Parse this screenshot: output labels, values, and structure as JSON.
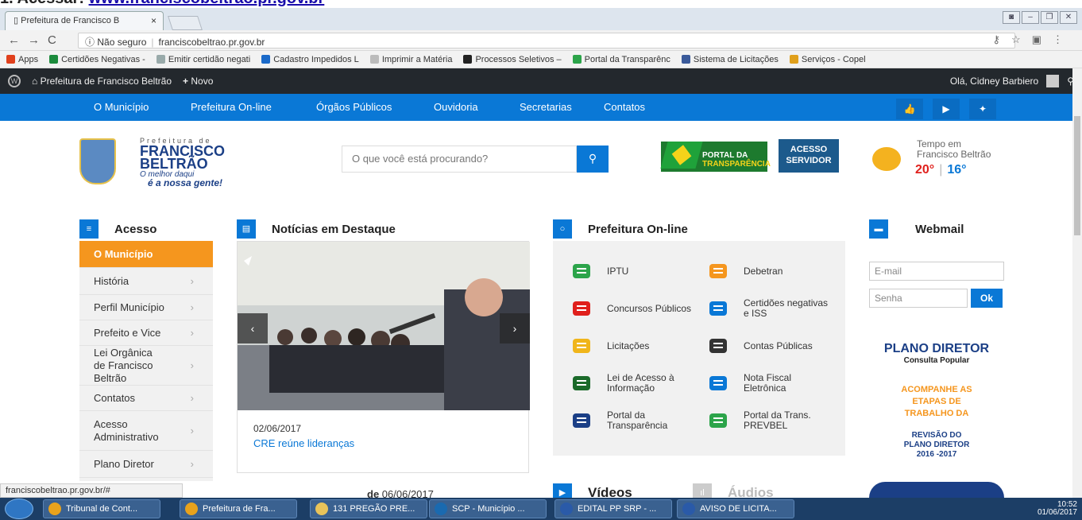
{
  "doc_header": {
    "prefix": "1. Acessar: ",
    "link": "www.franciscobeltrao.pr.gov.br"
  },
  "browser": {
    "tab_title": "Prefeitura de Francisco B",
    "security": "Não seguro",
    "url": "franciscobeltrao.pr.gov.br",
    "bookmarks": [
      {
        "label": "Apps",
        "color": "#e0401c"
      },
      {
        "label": "Certidões Negativas -",
        "color": "#1b8a3c"
      },
      {
        "label": "Emitir certidão negati",
        "color": "#9aa"
      },
      {
        "label": "Cadastro Impedidos L",
        "color": "#1b6ac9"
      },
      {
        "label": "Imprimir a Matéria",
        "color": "#bbb"
      },
      {
        "label": "Processos Seletivos –",
        "color": "#222"
      },
      {
        "label": "Portal da Transparênc",
        "color": "#2ca44a"
      },
      {
        "label": "Sistema de Licitações",
        "color": "#3a5a9a"
      },
      {
        "label": "Serviços - Copel",
        "color": "#e0a01c"
      }
    ]
  },
  "wp_bar": {
    "site": "Prefeitura de Francisco Beltrão",
    "new": "Novo",
    "greeting": "Olá, Cidney Barbiero"
  },
  "nav": [
    "O Município",
    "Prefeitura On-line",
    "Órgãos Públicos",
    "Ouvidoria",
    "Secretarias",
    "Contatos"
  ],
  "logo": {
    "line1": "Prefeitura de",
    "line2": "FRANCISCO",
    "line3": "BELTRÃO",
    "tag1": "O melhor daqui",
    "tag2": "é a nossa gente!"
  },
  "search": {
    "placeholder": "O que você está procurando?"
  },
  "portal": {
    "line1": "PORTAL DA",
    "line2": "TRANSPARÊNCIA"
  },
  "acesso_servidor": {
    "line1": "ACESSO",
    "line2": "SERVIDOR"
  },
  "weather": {
    "line1": "Tempo em",
    "line2": "Francisco Beltrão",
    "max": "20°",
    "min": "16°"
  },
  "sections": {
    "acesso": "Acesso",
    "noticias": "Notícias em Destaque",
    "online": "Prefeitura On-line",
    "webmail": "Webmail",
    "videos": "Vídeos",
    "audios": "Áudios"
  },
  "menu": [
    "O Município",
    "História",
    "Perfil Município",
    "Prefeito e Vice",
    "Lei Orgânica de Francisco Beltrão",
    "Contatos",
    "Acesso Administrativo",
    "Plano Diretor"
  ],
  "news": {
    "date": "02/06/2017",
    "caption": "CRE reúne lideranças",
    "next_date": "06/06/2017"
  },
  "online_services": [
    {
      "label": "IPTU",
      "icon": "house-icon",
      "color": "#2ca44a"
    },
    {
      "label": "Debetran",
      "icon": "car-icon",
      "color": "#f5961e"
    },
    {
      "label": "Concursos Públicos",
      "icon": "person-icon",
      "color": "#e0201c"
    },
    {
      "label": "Certidões negativas e ISS",
      "icon": "document-icon",
      "color": "#0a78d6"
    },
    {
      "label": "Licitações",
      "icon": "list-icon",
      "color": "#f0b51a"
    },
    {
      "label": "Contas Públicas",
      "icon": "calculator-icon",
      "color": "#333333"
    },
    {
      "label": "Lei de Acesso à Informação",
      "icon": "info-icon",
      "color": "#1b6a2a"
    },
    {
      "label": "Nota Fiscal Eletrônica",
      "icon": "invoice-icon",
      "color": "#0a78d6"
    },
    {
      "label": "Portal da Transparência",
      "icon": "magnifier-icon",
      "color": "#1b3f86"
    },
    {
      "label": "Portal da Trans. PREVBEL",
      "icon": "map-pin-icon",
      "color": "#2ca44a"
    }
  ],
  "webmail": {
    "email_placeholder": "E-mail",
    "password_placeholder": "Senha",
    "ok": "Ok"
  },
  "plano": {
    "title": "PLANO DIRETOR",
    "sub": "Consulta Popular",
    "cta": "ACOMPANHE AS ETAPAS DE TRABALHO DA",
    "rev": "REVISÃO DO PLANO DIRETOR",
    "years": "2016 -2017"
  },
  "status_url": "franciscobeltrao.pr.gov.br/#",
  "taskbar": [
    {
      "label": "Tribunal de Cont...",
      "color": "#e8a21c"
    },
    {
      "label": "Prefeitura de Fra...",
      "color": "#e8a21c"
    },
    {
      "label": "131 PREGÃO PRE...",
      "color": "#e8c35a"
    },
    {
      "label": "SCP - Município ...",
      "color": "#1a6ab0"
    },
    {
      "label": "EDITAL PP SRP - ...",
      "color": "#2a5aa8"
    },
    {
      "label": "AVISO DE LICITA...",
      "color": "#2a5aa8"
    }
  ],
  "clock": {
    "time": "10:52",
    "date": "01/06/2017"
  }
}
